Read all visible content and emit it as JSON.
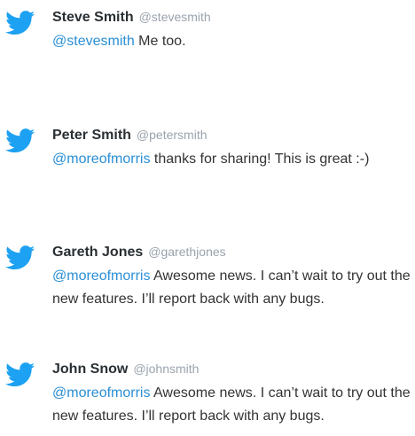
{
  "colors": {
    "brand": "#1da1f2",
    "mention": "#2a8fd6",
    "handle": "#9aa3ad",
    "name": "#292f33",
    "text": "#333333"
  },
  "tweets": [
    {
      "icon": "twitter-bird-icon",
      "name": "Steve Smith",
      "handle": "@stevesmith",
      "mention": "@stevesmith",
      "text": " Me too."
    },
    {
      "icon": "twitter-bird-icon",
      "name": "Peter Smith",
      "handle": "@petersmith",
      "mention": "@moreofmorris",
      "text": " thanks for sharing! This is great :-)"
    },
    {
      "icon": "twitter-bird-icon",
      "name": "Gareth Jones",
      "handle": "@garethjones",
      "mention": "@moreofmorris",
      "text": " Awesome news. I can’t wait to try out the new features. I’ll report back with any bugs."
    },
    {
      "icon": "twitter-bird-icon",
      "name": "John Snow",
      "handle": "@johnsmith",
      "mention": "@moreofmorris",
      "text": " Awesome news. I can’t wait to try out the new features. I’ll report back with any bugs."
    }
  ]
}
